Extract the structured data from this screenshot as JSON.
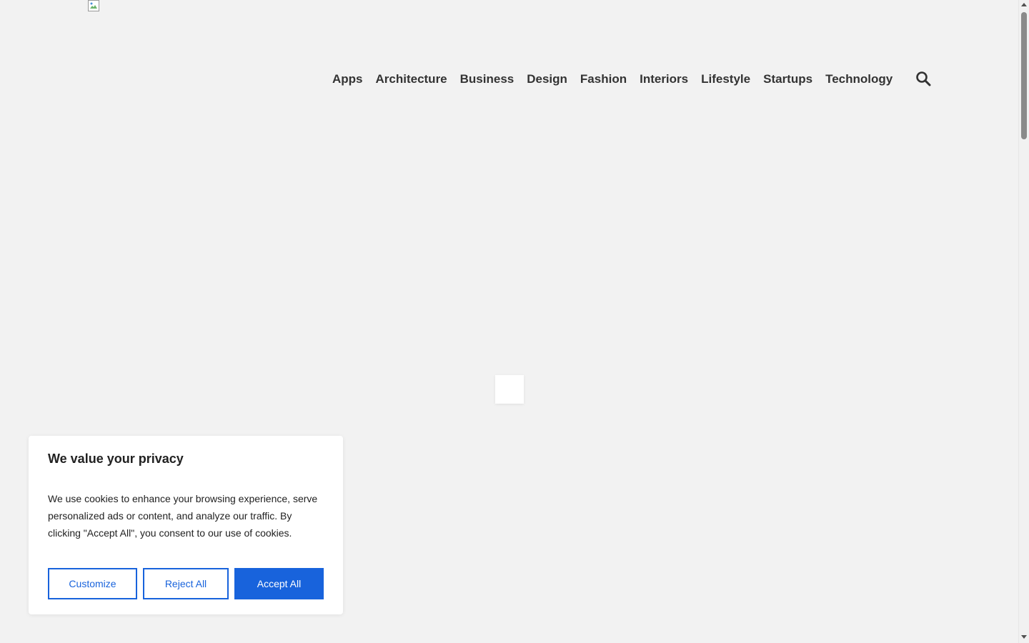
{
  "header": {
    "logo_alt": "",
    "nav": [
      {
        "label": "Apps"
      },
      {
        "label": "Architecture"
      },
      {
        "label": "Business"
      },
      {
        "label": "Design"
      },
      {
        "label": "Fashion"
      },
      {
        "label": "Interiors"
      },
      {
        "label": "Lifestyle"
      },
      {
        "label": "Startups"
      },
      {
        "label": "Technology"
      }
    ],
    "search_icon": "search-icon"
  },
  "cookie_banner": {
    "title": "We value your privacy",
    "text": "We use cookies to enhance your browsing experience, serve personalized ads or content, and analyze our traffic. By clicking \"Accept All\", you consent to our use of cookies.",
    "customize_label": "Customize",
    "reject_label": "Reject All",
    "accept_label": "Accept All"
  },
  "colors": {
    "background": "#f2f2f2",
    "accent": "#1863dc",
    "nav_text": "#333333"
  }
}
